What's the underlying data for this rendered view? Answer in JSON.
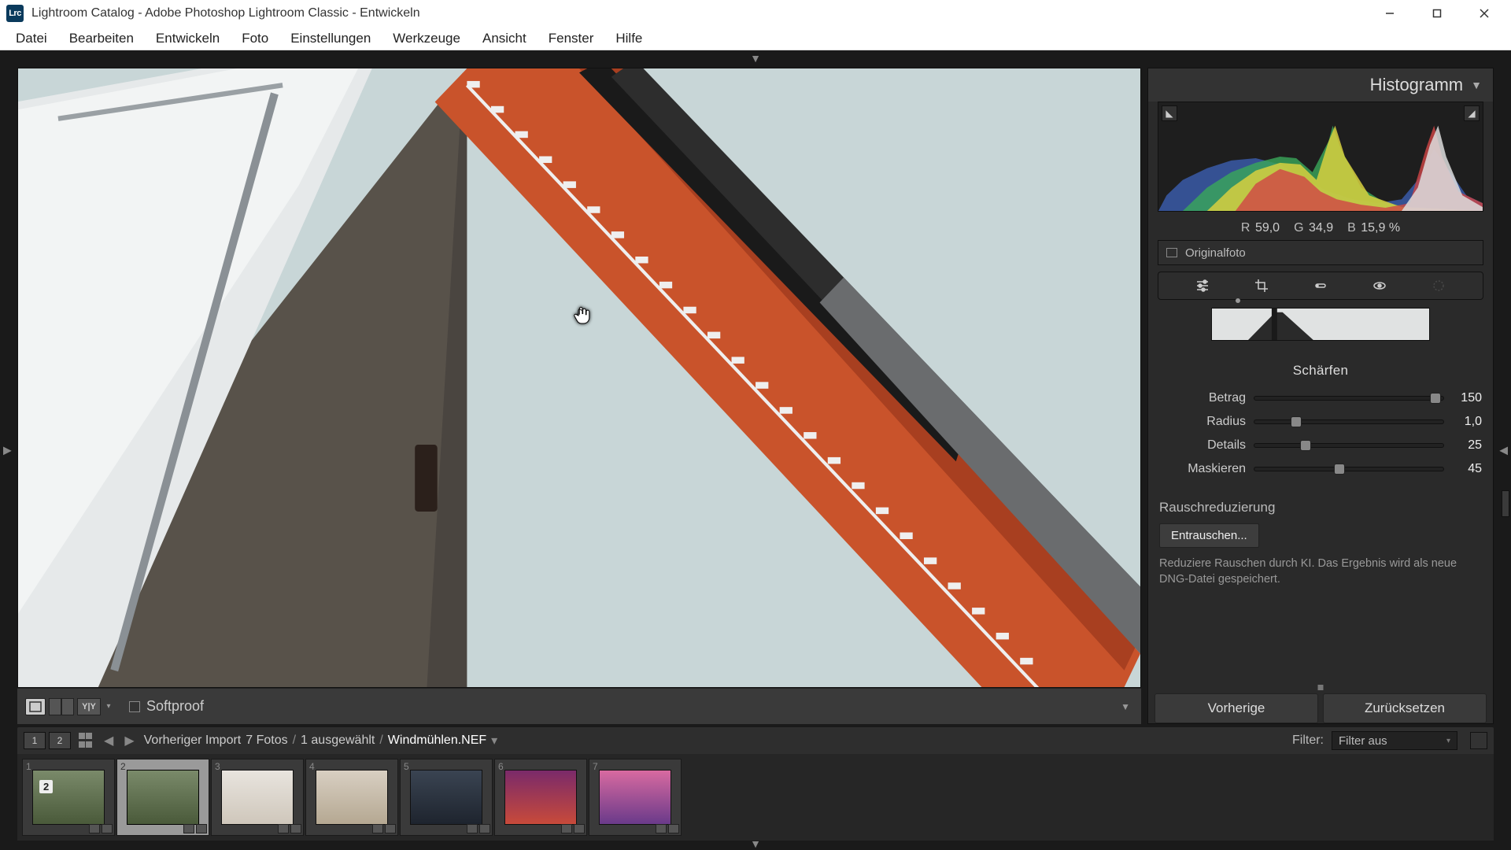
{
  "window": {
    "title": "Lightroom Catalog - Adobe Photoshop Lightroom Classic - Entwickeln",
    "logo_text": "Lrc"
  },
  "menu": [
    "Datei",
    "Bearbeiten",
    "Entwickeln",
    "Foto",
    "Einstellungen",
    "Werkzeuge",
    "Ansicht",
    "Fenster",
    "Hilfe"
  ],
  "toolbar": {
    "softproof_label": "Softproof"
  },
  "histogram": {
    "title": "Histogramm",
    "r_label": "R",
    "r_value": "59,0",
    "g_label": "G",
    "g_value": "34,9",
    "b_label": "B",
    "b_value": "15,9",
    "pct": "%",
    "original_label": "Originalfoto"
  },
  "detail": {
    "section_title": "Schärfen",
    "sliders": [
      {
        "label": "Betrag",
        "value": "150",
        "pos": 96
      },
      {
        "label": "Radius",
        "value": "1,0",
        "pos": 22
      },
      {
        "label": "Details",
        "value": "25",
        "pos": 27
      },
      {
        "label": "Maskieren",
        "value": "45",
        "pos": 45
      }
    ],
    "noise_title": "Rauschreduzierung",
    "noise_button": "Entrauschen...",
    "noise_desc": "Reduziere Rauschen durch KI. Das Ergebnis wird als neue DNG-Datei gespeichert."
  },
  "actions": {
    "previous": "Vorherige",
    "reset": "Zurücksetzen"
  },
  "filmstrip": {
    "display1": "1",
    "display2": "2",
    "crumb_source": "Vorheriger Import",
    "crumb_count": "7 Fotos",
    "crumb_selected": "1 ausgewählt",
    "crumb_file": "Windmühlen.NEF",
    "filter_label": "Filter:",
    "filter_value": "Filter aus",
    "thumbs": [
      {
        "idx": "1",
        "selected": false,
        "badge_count": "2"
      },
      {
        "idx": "2",
        "selected": true
      },
      {
        "idx": "3",
        "selected": false
      },
      {
        "idx": "4",
        "selected": false
      },
      {
        "idx": "5",
        "selected": false
      },
      {
        "idx": "6",
        "selected": false
      },
      {
        "idx": "7",
        "selected": false
      }
    ]
  }
}
